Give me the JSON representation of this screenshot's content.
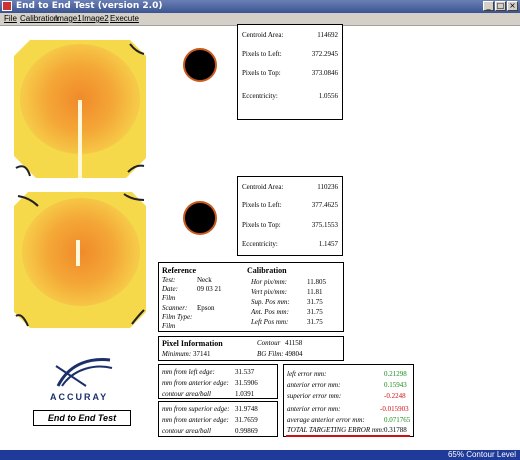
{
  "window": {
    "title": "End to End Test (version 2.0)"
  },
  "menu": [
    "File",
    "Calibration",
    "Image1",
    "Image2",
    "Execute"
  ],
  "image1_stats": {
    "rows": [
      {
        "label": "Centroid Area:",
        "value": "114692"
      },
      {
        "label": "Pixels to Left:",
        "value": "372.2945"
      },
      {
        "label": "Pixels to Top:",
        "value": "373.0846"
      },
      {
        "label": "Eccentricity:",
        "value": "1.0556"
      }
    ]
  },
  "image2_stats": {
    "rows": [
      {
        "label": "Centroid Area:",
        "value": "110236"
      },
      {
        "label": "Pixels to Left:",
        "value": "377.4625"
      },
      {
        "label": "Pixels to Top:",
        "value": "375.1553"
      },
      {
        "label": "Eccentricity:",
        "value": "1.1457"
      }
    ]
  },
  "reference": {
    "title": "Reference",
    "rows": [
      {
        "label": "Test:",
        "value": "Neck"
      },
      {
        "label": "Date:",
        "value": "09 03 21"
      },
      {
        "label": "Film",
        "value": ""
      },
      {
        "label": "Scanner:",
        "value": "Epson"
      },
      {
        "label": "Film Type:",
        "value": ""
      },
      {
        "label": "Film",
        "value": ""
      }
    ]
  },
  "calibration": {
    "title": "Calibration",
    "rows": [
      {
        "label": "Hor pix/mm:",
        "value": "11.805"
      },
      {
        "label": "Vert pix/mm:",
        "value": "11.81"
      },
      {
        "label": "Sup. Pos mm:",
        "value": "31.75"
      },
      {
        "label": "Ant. Pos mm:",
        "value": "31.75"
      },
      {
        "label": "Left Pos mm:",
        "value": "31.75"
      }
    ]
  },
  "pixel_info": {
    "title": "Pixel Information",
    "contour_label": "Contour",
    "contour_value": "41158",
    "minimum_label": "Minimum:",
    "minimum_value": "37141",
    "bgfilm_label": "BG Film:",
    "bgfilm_value": "49804"
  },
  "measure1": [
    {
      "label": "mm from left edge:",
      "value": "31.537"
    },
    {
      "label": "mm from anterior edge:",
      "value": "31.5906"
    },
    {
      "label": "contour area/ball",
      "value": "1.0391"
    }
  ],
  "measure2": [
    {
      "label": "mm from superior edge:",
      "value": "31.9748"
    },
    {
      "label": "mm from anterior edge:",
      "value": "31.7659"
    },
    {
      "label": "contour area/ball",
      "value": "0.99869"
    }
  ],
  "errors": [
    {
      "label": "left error mm:",
      "value": "0.21298",
      "color": "#1a8a1a"
    },
    {
      "label": "anterior error mm:",
      "value": "0.15943",
      "color": "#1a8a1a"
    },
    {
      "label": "superior error mm:",
      "value": "-0.2248",
      "color": "#d01010"
    },
    {
      "label": "anterior error mm:",
      "value": "-0.015903",
      "color": "#d01010"
    },
    {
      "label": "average anterior error mm:",
      "value": "0.071765",
      "color": "#1a8a1a"
    },
    {
      "label": "TOTAL TARGETING ERROR mm:",
      "value": "0.31788",
      "color": "#000000"
    }
  ],
  "logo": {
    "text": "ACCURAY"
  },
  "end_button": {
    "label": "End to End Test"
  },
  "status": {
    "text": "65% Contour Level"
  },
  "colors": {
    "titlebar": "#3b5491",
    "status_bar": "#1f3a99",
    "total_underline": "#d01010"
  }
}
